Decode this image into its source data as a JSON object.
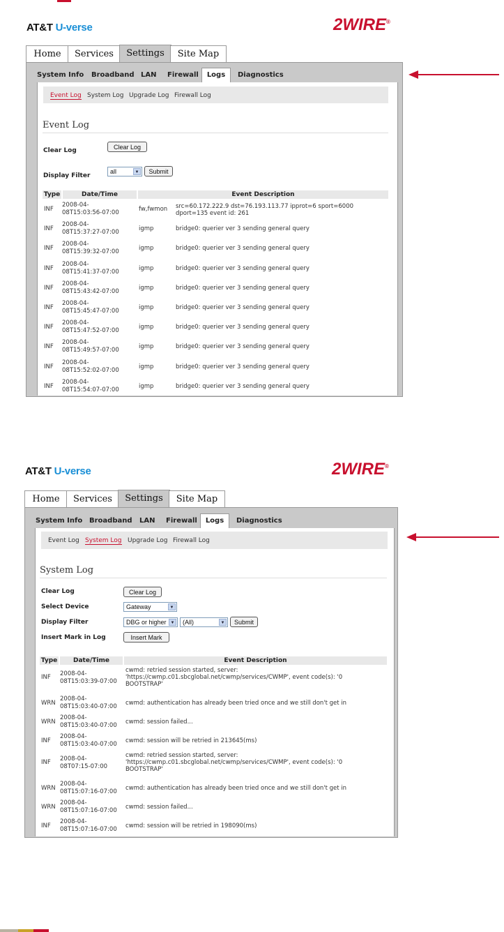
{
  "brand": {
    "att": "AT&T",
    "uverse": "U-verse",
    "logo": "2WIRE",
    "reg": "®"
  },
  "main_tabs": [
    "Home",
    "Services",
    "Settings",
    "Site Map"
  ],
  "sub_tabs": [
    "System Info",
    "Broadband",
    "LAN",
    "Firewall",
    "Logs",
    "Diagnostics"
  ],
  "log_tabs": [
    "Event Log",
    "System Log",
    "Upgrade Log",
    "Firewall Log"
  ],
  "event_log": {
    "title": "Event Log",
    "clear_label": "Clear Log",
    "clear_button": "Clear Log",
    "filter_label": "Display Filter",
    "filter_value": "all",
    "submit": "Submit",
    "columns": [
      "Type",
      "Date/Time",
      "Event Description"
    ],
    "rows": [
      {
        "type": "INF",
        "date": "2008-04-",
        "time": "08T15:03:56-07:00",
        "src": "fw,fwmon",
        "desc1": "src=60.172.222.9 dst=76.193.113.77 ipprot=6 sport=6000",
        "desc2": "dport=135 event id: 261"
      },
      {
        "type": "INF",
        "date": "2008-04-",
        "time": "08T15:37:27-07:00",
        "src": "igmp",
        "desc1": "bridge0: querier ver 3 sending general query",
        "desc2": ""
      },
      {
        "type": "INF",
        "date": "2008-04-",
        "time": "08T15:39:32-07:00",
        "src": "igmp",
        "desc1": "bridge0: querier ver 3 sending general query",
        "desc2": ""
      },
      {
        "type": "INF",
        "date": "2008-04-",
        "time": "08T15:41:37-07:00",
        "src": "igmp",
        "desc1": "bridge0: querier ver 3 sending general query",
        "desc2": ""
      },
      {
        "type": "INF",
        "date": "2008-04-",
        "time": "08T15:43:42-07:00",
        "src": "igmp",
        "desc1": "bridge0: querier ver 3 sending general query",
        "desc2": ""
      },
      {
        "type": "INF",
        "date": "2008-04-",
        "time": "08T15:45:47-07:00",
        "src": "igmp",
        "desc1": "bridge0: querier ver 3 sending general query",
        "desc2": ""
      },
      {
        "type": "INF",
        "date": "2008-04-",
        "time": "08T15:47:52-07:00",
        "src": "igmp",
        "desc1": "bridge0: querier ver 3 sending general query",
        "desc2": ""
      },
      {
        "type": "INF",
        "date": "2008-04-",
        "time": "08T15:49:57-07:00",
        "src": "igmp",
        "desc1": "bridge0: querier ver 3 sending general query",
        "desc2": ""
      },
      {
        "type": "INF",
        "date": "2008-04-",
        "time": "08T15:52:02-07:00",
        "src": "igmp",
        "desc1": "bridge0: querier ver 3 sending general query",
        "desc2": ""
      },
      {
        "type": "INF",
        "date": "2008-04-",
        "time": "08T15:54:07-07:00",
        "src": "igmp",
        "desc1": "bridge0: querier ver 3 sending general query",
        "desc2": ""
      }
    ]
  },
  "system_log": {
    "title": "System Log",
    "clear_label": "Clear Log",
    "clear_button": "Clear Log",
    "device_label": "Select Device",
    "device_value": "Gateway",
    "filter_label": "Display Filter",
    "filter_value": "DBG or higher",
    "filter2_value": "(All)",
    "submit": "Submit",
    "mark_label": "Insert Mark in Log",
    "mark_button": "Insert Mark",
    "columns": [
      "Type",
      "Date/Time",
      "Event Description"
    ],
    "rows": [
      {
        "type": "INF",
        "date": "2008-04-",
        "time": "08T15:03:39-07:00",
        "lines": [
          "cwmd: retried session started, server:",
          "'https://cwmp.c01.sbcglobal.net/cwmp/services/CWMP', event code(s): '0",
          "BOOTSTRAP'"
        ]
      },
      {
        "type": "WRN",
        "date": "2008-04-",
        "time": "08T15:03:40-07:00",
        "lines": [
          "cwmd: authentication has already been tried once and we still don't get in"
        ]
      },
      {
        "type": "WRN",
        "date": "2008-04-",
        "time": "08T15:03:40-07:00",
        "lines": [
          "cwmd: session failed..."
        ]
      },
      {
        "type": "INF",
        "date": "2008-04-",
        "time": "08T15:03:40-07:00",
        "lines": [
          "cwmd: session will be retried in 213645(ms)"
        ]
      },
      {
        "type": "INF",
        "date": "2008-04-",
        "time": "08T07:15-07:00",
        "lines": [
          "cwmd: retried session started, server:",
          "'https://cwmp.c01.sbcglobal.net/cwmp/services/CWMP', event code(s): '0",
          "BOOTSTRAP'"
        ]
      },
      {
        "type": "WRN",
        "date": "2008-04-",
        "time": "08T15:07:16-07:00",
        "lines": [
          "cwmd: authentication has already been tried once and we still don't get in"
        ]
      },
      {
        "type": "WRN",
        "date": "2008-04-",
        "time": "08T15:07:16-07:00",
        "lines": [
          "cwmd: session failed..."
        ]
      },
      {
        "type": "INF",
        "date": "2008-04-",
        "time": "08T15:07:16-07:00",
        "lines": [
          "cwmd: session will be retried in 198090(ms)"
        ]
      }
    ]
  },
  "colors": {
    "accent": "#c8102e",
    "uverse_blue": "#1a8fd6",
    "frame": "#c9c9c9",
    "log_bar": "#e8e8e8"
  }
}
